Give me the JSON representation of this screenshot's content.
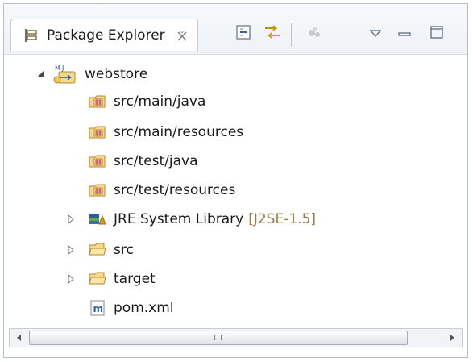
{
  "view": {
    "tab_title": "Package Explorer",
    "icons": {
      "tab": "package-explorer-icon",
      "close": "close-icon",
      "collapse_all": "collapse-all-icon",
      "link_with_editor": "link-with-editor-icon",
      "focus": "focus-on-active-task-icon",
      "view_menu": "view-menu-icon",
      "minimize": "minimize-icon",
      "maximize": "maximize-icon"
    }
  },
  "tree": {
    "project": {
      "label": "webstore",
      "expanded": true,
      "icon": "maven-project-icon"
    },
    "items": [
      {
        "label": "src/main/java",
        "icon": "source-folder-icon"
      },
      {
        "label": "src/main/resources",
        "icon": "source-folder-icon"
      },
      {
        "label": "src/test/java",
        "icon": "source-folder-icon"
      },
      {
        "label": "src/test/resources",
        "icon": "source-folder-icon"
      },
      {
        "label": "JRE System Library",
        "decoration": "[J2SE-1.5]",
        "icon": "library-icon",
        "expandable": true
      },
      {
        "label": "src",
        "icon": "folder-icon",
        "expandable": true
      },
      {
        "label": "target",
        "icon": "folder-icon",
        "expandable": true
      },
      {
        "label": "pom.xml",
        "icon": "maven-file-icon"
      }
    ]
  },
  "scrollbar": {
    "grip": "III"
  },
  "colors": {
    "folder_fill": "#f4d98a",
    "folder_stroke": "#b8862b",
    "decoration": "#9a7b3f",
    "maven_blue": "#2f5fa8"
  }
}
